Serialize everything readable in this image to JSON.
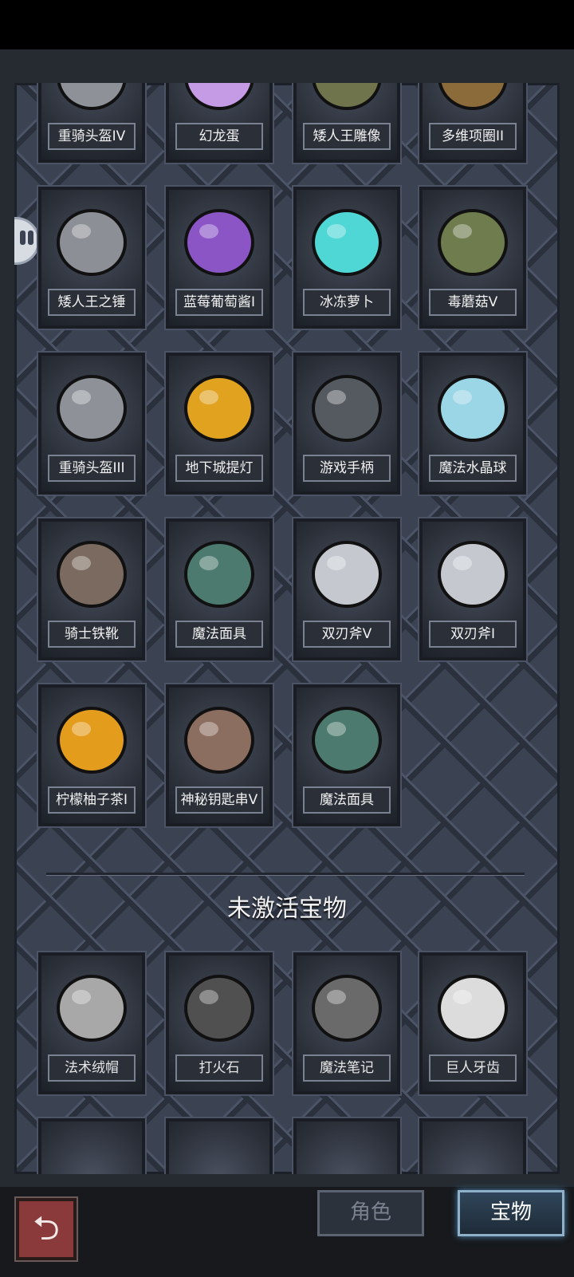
{
  "owned_items": [
    {
      "name": "重骑头盔IV",
      "icon": "heavy-helmet-icon"
    },
    {
      "name": "幻龙蛋",
      "icon": "dragon-egg-icon"
    },
    {
      "name": "矮人王雕像",
      "icon": "statue-icon"
    },
    {
      "name": "多维项圈II",
      "icon": "collar-icon"
    },
    {
      "name": "矮人王之锤",
      "icon": "hammer-icon"
    },
    {
      "name": "蓝莓葡萄酱I",
      "icon": "jam-bottle-icon"
    },
    {
      "name": "冰冻萝卜",
      "icon": "frozen-radish-icon"
    },
    {
      "name": "毒蘑菇V",
      "icon": "poison-mushroom-icon"
    },
    {
      "name": "重骑头盔III",
      "icon": "heavy-helmet-icon"
    },
    {
      "name": "地下城提灯",
      "icon": "lantern-icon"
    },
    {
      "name": "游戏手柄",
      "icon": "gamepad-icon"
    },
    {
      "name": "魔法水晶球",
      "icon": "crystal-ball-icon"
    },
    {
      "name": "骑士铁靴",
      "icon": "iron-boots-icon"
    },
    {
      "name": "魔法面具",
      "icon": "magic-mask-icon"
    },
    {
      "name": "双刃斧V",
      "icon": "double-axe-icon"
    },
    {
      "name": "双刃斧I",
      "icon": "double-axe-icon"
    },
    {
      "name": "柠檬柚子茶I",
      "icon": "tea-bottle-icon"
    },
    {
      "name": "神秘钥匙串V",
      "icon": "keyring-icon"
    },
    {
      "name": "魔法面具",
      "icon": "magic-mask-icon"
    }
  ],
  "inactive_title": "未激活宝物",
  "inactive_items": [
    {
      "name": "法术绒帽",
      "icon": "fur-hat-icon"
    },
    {
      "name": "打火石",
      "icon": "flint-stone-icon"
    },
    {
      "name": "魔法笔记",
      "icon": "spell-book-icon"
    },
    {
      "name": "巨人牙齿",
      "icon": "giant-tooth-icon"
    }
  ],
  "tabs": {
    "role": "角色",
    "treasure": "宝物"
  },
  "back_symbol": "⮌"
}
